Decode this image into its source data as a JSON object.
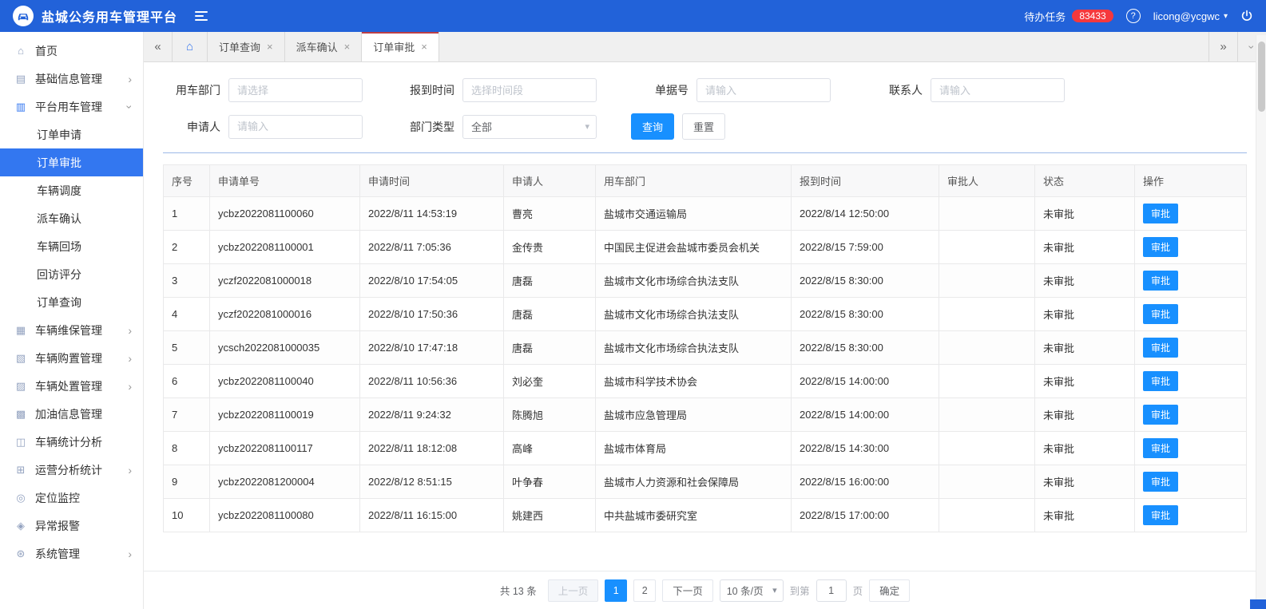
{
  "colors": {
    "header_blue": "#2262d9",
    "accent_blue": "#3377f0",
    "button_blue": "#1890ff",
    "badge_red": "#f5383d"
  },
  "icons": {
    "home": "⌂",
    "base_info": "▤",
    "platform": "▥",
    "maintenance": "▦",
    "purchase": "▧",
    "disposal": "▨",
    "fuel": "▩",
    "stats": "◫",
    "operations": "⊞",
    "location": "◎",
    "alarm": "◈",
    "system": "⊛",
    "chevron": "›",
    "collapse_left": "«",
    "expand_right": "»",
    "close": "×",
    "caret_down": "▾",
    "help": "?"
  },
  "header": {
    "title": "盐城公务用车管理平台",
    "todo_label": "待办任务",
    "todo_count": "83433",
    "username": "licong@ycgwc"
  },
  "sidebar": {
    "items": [
      {
        "label": "首页"
      },
      {
        "label": "基础信息管理"
      },
      {
        "label": "平台用车管理",
        "children": [
          "订单申请",
          "订单审批",
          "车辆调度",
          "派车确认",
          "车辆回场",
          "回访评分",
          "订单查询"
        ],
        "active_child": "订单审批"
      },
      {
        "label": "车辆维保管理"
      },
      {
        "label": "车辆购置管理"
      },
      {
        "label": "车辆处置管理"
      },
      {
        "label": "加油信息管理"
      },
      {
        "label": "车辆统计分析"
      },
      {
        "label": "运营分析统计"
      },
      {
        "label": "定位监控"
      },
      {
        "label": "异常报警"
      },
      {
        "label": "系统管理"
      }
    ]
  },
  "tabs": {
    "items": [
      "订单查询",
      "派车确认",
      "订单审批"
    ],
    "active": "订单审批"
  },
  "filters": {
    "department": {
      "label": "用车部门",
      "placeholder": "请选择"
    },
    "report_time": {
      "label": "报到时间",
      "placeholder": "选择时间段"
    },
    "doc_no": {
      "label": "单据号",
      "placeholder": "请输入"
    },
    "contact": {
      "label": "联系人",
      "placeholder": "请输入"
    },
    "applicant": {
      "label": "申请人",
      "placeholder": "请输入"
    },
    "dept_type": {
      "label": "部门类型",
      "value": "全部"
    },
    "search_label": "查询",
    "reset_label": "重置"
  },
  "table": {
    "columns": [
      "序号",
      "申请单号",
      "申请时间",
      "申请人",
      "用车部门",
      "报到时间",
      "审批人",
      "状态",
      "操作"
    ],
    "action_label": "审批",
    "rows": [
      {
        "seq": "1",
        "order_no": "ycbz2022081100060",
        "apply_time": "2022/8/11 14:53:19",
        "applicant": "曹亮",
        "department": "盐城市交通运输局",
        "report_time": "2022/8/14 12:50:00",
        "approver": "",
        "status": "未审批"
      },
      {
        "seq": "2",
        "order_no": "ycbz2022081100001",
        "apply_time": "2022/8/11 7:05:36",
        "applicant": "金传贵",
        "department": "中国民主促进会盐城市委员会机关",
        "report_time": "2022/8/15 7:59:00",
        "approver": "",
        "status": "未审批"
      },
      {
        "seq": "3",
        "order_no": "yczf2022081000018",
        "apply_time": "2022/8/10 17:54:05",
        "applicant": "唐磊",
        "department": "盐城市文化市场综合执法支队",
        "report_time": "2022/8/15 8:30:00",
        "approver": "",
        "status": "未审批"
      },
      {
        "seq": "4",
        "order_no": "yczf2022081000016",
        "apply_time": "2022/8/10 17:50:36",
        "applicant": "唐磊",
        "department": "盐城市文化市场综合执法支队",
        "report_time": "2022/8/15 8:30:00",
        "approver": "",
        "status": "未审批"
      },
      {
        "seq": "5",
        "order_no": "ycsch2022081000035",
        "apply_time": "2022/8/10 17:47:18",
        "applicant": "唐磊",
        "department": "盐城市文化市场综合执法支队",
        "report_time": "2022/8/15 8:30:00",
        "approver": "",
        "status": "未审批"
      },
      {
        "seq": "6",
        "order_no": "ycbz2022081100040",
        "apply_time": "2022/8/11 10:56:36",
        "applicant": "刘必奎",
        "department": "盐城市科学技术协会",
        "report_time": "2022/8/15 14:00:00",
        "approver": "",
        "status": "未审批"
      },
      {
        "seq": "7",
        "order_no": "ycbz2022081100019",
        "apply_time": "2022/8/11 9:24:32",
        "applicant": "陈腾旭",
        "department": "盐城市应急管理局",
        "report_time": "2022/8/15 14:00:00",
        "approver": "",
        "status": "未审批"
      },
      {
        "seq": "8",
        "order_no": "ycbz2022081100117",
        "apply_time": "2022/8/11 18:12:08",
        "applicant": "高峰",
        "department": "盐城市体育局",
        "report_time": "2022/8/15 14:30:00",
        "approver": "",
        "status": "未审批"
      },
      {
        "seq": "9",
        "order_no": "ycbz2022081200004",
        "apply_time": "2022/8/12 8:51:15",
        "applicant": "叶争春",
        "department": "盐城市人力资源和社会保障局",
        "report_time": "2022/8/15 16:00:00",
        "approver": "",
        "status": "未审批"
      },
      {
        "seq": "10",
        "order_no": "ycbz2022081100080",
        "apply_time": "2022/8/11 16:15:00",
        "applicant": "姚建西",
        "department": "中共盐城市委研究室",
        "report_time": "2022/8/15 17:00:00",
        "approver": "",
        "status": "未审批"
      }
    ]
  },
  "pagination": {
    "total": "共 13 条",
    "prev": "上一页",
    "pages": [
      "1",
      "2"
    ],
    "active_page": "1",
    "next": "下一页",
    "page_size": "10 条/页",
    "jump_prefix": "到第",
    "jump_value": "1",
    "jump_suffix": "页",
    "confirm": "确定"
  }
}
